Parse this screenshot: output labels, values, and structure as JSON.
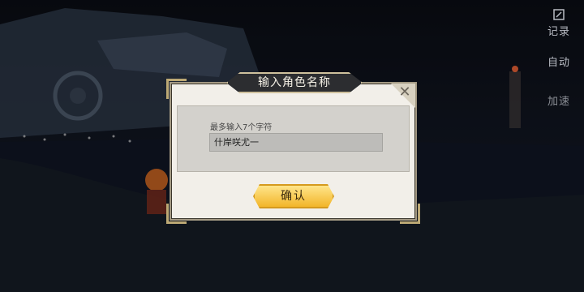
{
  "side_menu": {
    "record_label": "记录",
    "auto_label": "自动",
    "speed_label": "加速"
  },
  "dialog": {
    "title": "输入角色名称",
    "hint": "最多输入7个字符",
    "name_value": "什岸咲尤一",
    "confirm_label": "确认",
    "close_glyph": "✕"
  },
  "colors": {
    "dialog_bg": "#f2efe9",
    "title_plate": "#2c2d30",
    "confirm_button": "#f2b52a",
    "side_text": "#b9bcc4"
  }
}
